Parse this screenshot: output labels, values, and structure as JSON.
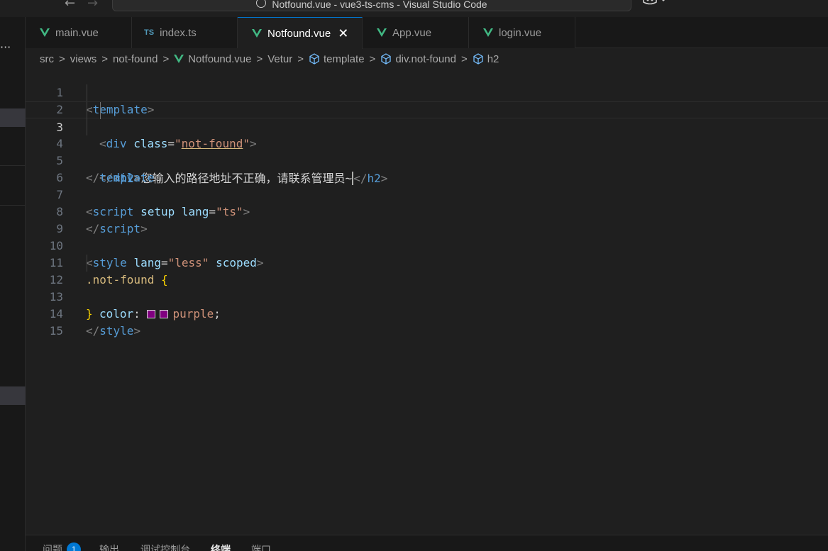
{
  "window": {
    "title": "Notfound.vue - vue3-ts-cms - Visual Studio Code",
    "back_glyph": "←",
    "forward_glyph": "→"
  },
  "sidebar": {
    "more_glyph": "···"
  },
  "tabs": [
    {
      "label": "main.vue",
      "icon": "vue-icon",
      "active": false
    },
    {
      "label": "index.ts",
      "icon": "ts-icon",
      "icon_text": "TS",
      "active": false
    },
    {
      "label": "Notfound.vue",
      "icon": "vue-icon",
      "active": true,
      "close_glyph": "✕"
    },
    {
      "label": "App.vue",
      "icon": "vue-icon",
      "active": false
    },
    {
      "label": "login.vue",
      "icon": "vue-icon",
      "active": false
    }
  ],
  "breadcrumb": {
    "items": [
      "src",
      "views",
      "not-found",
      "Notfound.vue",
      "Vetur",
      "template",
      "div.not-found",
      "h2"
    ],
    "separator": ">"
  },
  "editor": {
    "current_line": 3,
    "line_numbers": [
      "1",
      "2",
      "3",
      "4",
      "5",
      "6",
      "7",
      "8",
      "9",
      "10",
      "11",
      "12",
      "13",
      "14",
      "15"
    ],
    "tokens": {
      "l1_tag": "template",
      "l2_tag": "div",
      "l2_attr": "class",
      "l2_value": "not-found",
      "l3_tag": "h2",
      "l3_text": "您输入的路径地址不正确，请联系管理员~",
      "l3_close": "h2",
      "l4_tag": "div",
      "l5_tag": "template",
      "l7_tag": "script",
      "l7_attr1": "setup",
      "l7_attr2": "lang",
      "l7_value": "ts",
      "l8_tag": "script",
      "l10_tag": "style",
      "l10_attr1": "lang",
      "l10_value": "less",
      "l10_attr2": "scoped",
      "l11_selector": ".not-found",
      "l12_prop": "color",
      "l12_value": "purple",
      "l14_tag": "style"
    },
    "swatch_color": "#800080"
  },
  "panel": {
    "tabs": [
      "问题",
      "输出",
      "调试控制台",
      "终端",
      "端口"
    ],
    "active_tab": "终端",
    "problems_count": "1"
  },
  "colors": {
    "accent": "#0078d4",
    "vue_green": "#41b883",
    "ts_blue": "#519aba",
    "tag": "#569cd6",
    "attr": "#9cdcfe",
    "string": "#ce9178",
    "selector": "#d7ba7d",
    "brace": "#ffd700"
  }
}
